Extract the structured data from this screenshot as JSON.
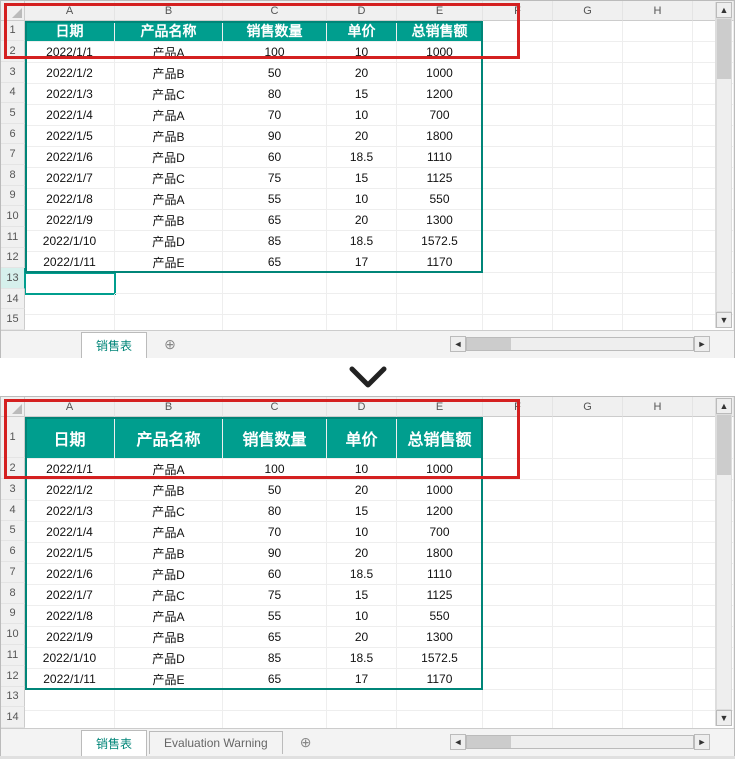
{
  "columns": [
    "A",
    "B",
    "C",
    "D",
    "E",
    "F",
    "G",
    "H"
  ],
  "headers": [
    "日期",
    "产品名称",
    "销售数量",
    "单价",
    "总销售额"
  ],
  "rows": [
    {
      "date": "2022/1/1",
      "name": "产品A",
      "qty": "100",
      "price": "10",
      "total": "1000"
    },
    {
      "date": "2022/1/2",
      "name": "产品B",
      "qty": "50",
      "price": "20",
      "total": "1000"
    },
    {
      "date": "2022/1/3",
      "name": "产品C",
      "qty": "80",
      "price": "15",
      "total": "1200"
    },
    {
      "date": "2022/1/4",
      "name": "产品A",
      "qty": "70",
      "price": "10",
      "total": "700"
    },
    {
      "date": "2022/1/5",
      "name": "产品B",
      "qty": "90",
      "price": "20",
      "total": "1800"
    },
    {
      "date": "2022/1/6",
      "name": "产品D",
      "qty": "60",
      "price": "18.5",
      "total": "1110"
    },
    {
      "date": "2022/1/7",
      "name": "产品C",
      "qty": "75",
      "price": "15",
      "total": "1125"
    },
    {
      "date": "2022/1/8",
      "name": "产品A",
      "qty": "55",
      "price": "10",
      "total": "550"
    },
    {
      "date": "2022/1/9",
      "name": "产品B",
      "qty": "65",
      "price": "20",
      "total": "1300"
    },
    {
      "date": "2022/1/10",
      "name": "产品D",
      "qty": "85",
      "price": "18.5",
      "total": "1572.5"
    },
    {
      "date": "2022/1/11",
      "name": "产品E",
      "qty": "65",
      "price": "17",
      "total": "1170"
    }
  ],
  "pane1": {
    "extra_row_labels": [
      "13",
      "14",
      "15"
    ],
    "tab_name": "销售表",
    "red_box_rows": 2
  },
  "pane2": {
    "extra_row_labels": [
      "13",
      "14"
    ],
    "tab_name": "销售表",
    "second_tab": "Evaluation Warning",
    "red_box_rows": 2
  },
  "chart_data": {
    "type": "table",
    "title": "销售表",
    "columns": [
      "日期",
      "产品名称",
      "销售数量",
      "单价",
      "总销售额"
    ],
    "data": [
      [
        "2022/1/1",
        "产品A",
        100,
        10,
        1000
      ],
      [
        "2022/1/2",
        "产品B",
        50,
        20,
        1000
      ],
      [
        "2022/1/3",
        "产品C",
        80,
        15,
        1200
      ],
      [
        "2022/1/4",
        "产品A",
        70,
        10,
        700
      ],
      [
        "2022/1/5",
        "产品B",
        90,
        20,
        1800
      ],
      [
        "2022/1/6",
        "产品D",
        60,
        18.5,
        1110
      ],
      [
        "2022/1/7",
        "产品C",
        75,
        15,
        1125
      ],
      [
        "2022/1/8",
        "产品A",
        55,
        10,
        550
      ],
      [
        "2022/1/9",
        "产品B",
        65,
        20,
        1300
      ],
      [
        "2022/1/10",
        "产品D",
        85,
        18.5,
        1572.5
      ],
      [
        "2022/1/11",
        "产品E",
        65,
        17,
        1170
      ]
    ]
  }
}
